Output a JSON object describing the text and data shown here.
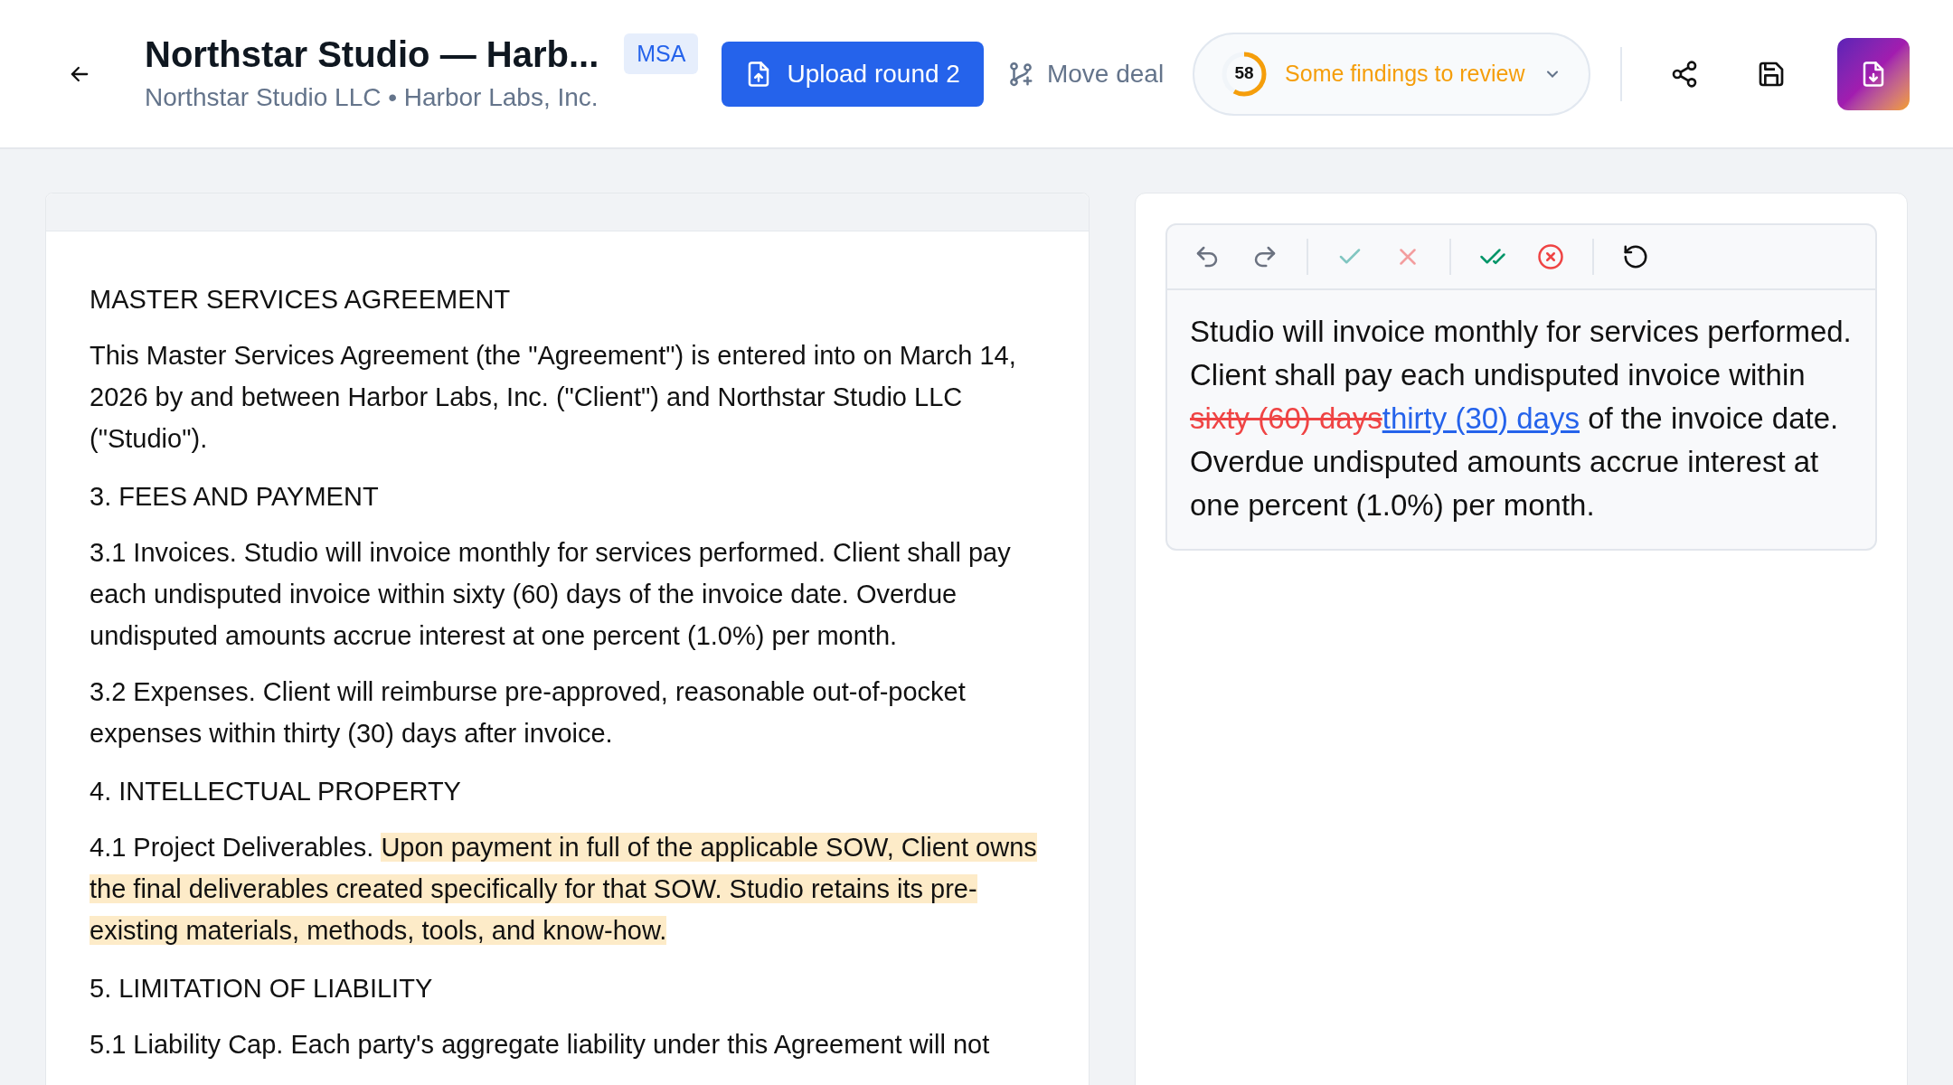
{
  "header": {
    "title": "Northstar Studio — Harb...",
    "subtitle": "Northstar Studio LLC • Harbor Labs, Inc.",
    "badge": "MSA",
    "upload_button": "Upload round 2",
    "move_button": "Move deal",
    "findings": {
      "score": "58",
      "level": 0.58,
      "label": "Some findings to review"
    }
  },
  "document": {
    "paragraphs": [
      {
        "kind": "heading",
        "segments": [
          {
            "text": "MASTER SERVICES AGREEMENT",
            "highlighted": false
          }
        ]
      },
      {
        "kind": "para",
        "segments": [
          {
            "text": "This Master Services Agreement (the \"Agreement\") is entered into on March 14, 2026 by and between Harbor Labs, Inc. (\"Client\") and Northstar Studio LLC (\"Studio\").",
            "highlighted": false
          }
        ]
      },
      {
        "kind": "heading",
        "segments": [
          {
            "text": "3. FEES AND PAYMENT",
            "highlighted": false
          }
        ]
      },
      {
        "kind": "para",
        "segments": [
          {
            "text": "3.1 Invoices. Studio will invoice monthly for services performed. Client shall pay each undisputed invoice within sixty (60) days of the invoice date. Overdue undisputed amounts accrue interest at one percent (1.0%) per month.",
            "highlighted": false
          }
        ]
      },
      {
        "kind": "para",
        "segments": [
          {
            "text": "3.2 Expenses. Client will reimburse pre-approved, reasonable out-of-pocket expenses within thirty (30) days after invoice.",
            "highlighted": false
          }
        ]
      },
      {
        "kind": "heading",
        "segments": [
          {
            "text": "4. INTELLECTUAL PROPERTY",
            "highlighted": false
          }
        ]
      },
      {
        "kind": "para",
        "segments": [
          {
            "text": "4.1 Project Deliverables. ",
            "highlighted": false
          },
          {
            "text": "Upon payment in full of the applicable SOW, Client owns the final deliverables created specifically for that SOW. Studio retains its pre-existing materials, methods, tools, and know-how.",
            "highlighted": true
          }
        ]
      },
      {
        "kind": "heading",
        "segments": [
          {
            "text": "5. LIMITATION OF LIABILITY",
            "highlighted": false
          }
        ]
      },
      {
        "kind": "para",
        "segments": [
          {
            "text": "5.1 Liability Cap. Each party's aggregate liability under this Agreement will not",
            "highlighted": false
          }
        ]
      }
    ]
  },
  "editor": {
    "tools": [
      {
        "kind": "undo",
        "disabled": false
      },
      {
        "kind": "redo",
        "disabled": false
      },
      {
        "kind": "divider"
      },
      {
        "kind": "accept",
        "disabled": true
      },
      {
        "kind": "reject",
        "disabled": true
      },
      {
        "kind": "divider"
      },
      {
        "kind": "accept_all",
        "disabled": false
      },
      {
        "kind": "reject_all",
        "disabled": false
      },
      {
        "kind": "divider"
      },
      {
        "kind": "reset",
        "disabled": false
      }
    ],
    "segments": [
      {
        "kind": "plain",
        "text": "Studio will invoice monthly for services performed. Client shall pay each undisputed invoice within "
      },
      {
        "kind": "deleted",
        "text": "sixty (60) days"
      },
      {
        "kind": "inserted",
        "text": "thirty (30) days"
      },
      {
        "kind": "plain",
        "text": " of the invoice date. Overdue undisputed amounts accrue interest at one percent (1.0%) per month."
      }
    ]
  }
}
